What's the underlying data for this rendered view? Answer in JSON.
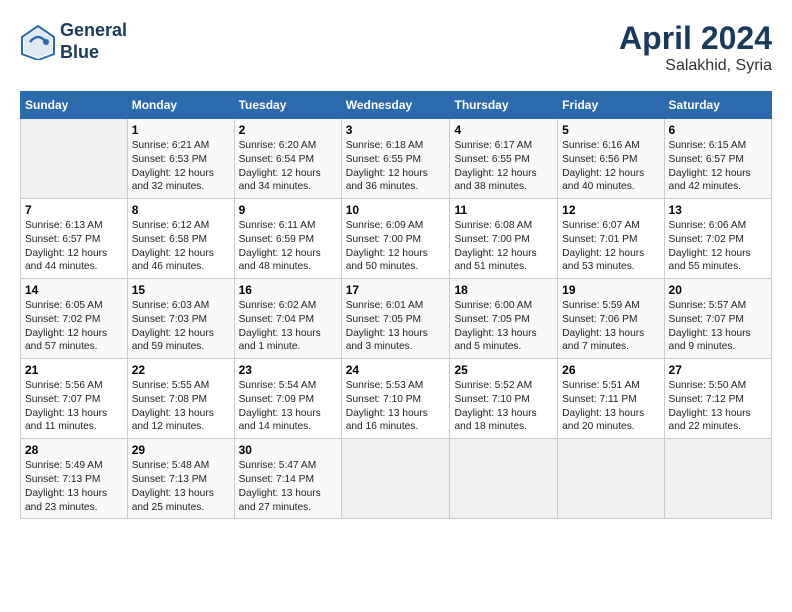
{
  "header": {
    "logo_line1": "General",
    "logo_line2": "Blue",
    "month": "April 2024",
    "location": "Salakhid, Syria"
  },
  "columns": [
    "Sunday",
    "Monday",
    "Tuesday",
    "Wednesday",
    "Thursday",
    "Friday",
    "Saturday"
  ],
  "rows": [
    [
      {
        "day": "",
        "info": ""
      },
      {
        "day": "1",
        "info": "Sunrise: 6:21 AM\nSunset: 6:53 PM\nDaylight: 12 hours\nand 32 minutes."
      },
      {
        "day": "2",
        "info": "Sunrise: 6:20 AM\nSunset: 6:54 PM\nDaylight: 12 hours\nand 34 minutes."
      },
      {
        "day": "3",
        "info": "Sunrise: 6:18 AM\nSunset: 6:55 PM\nDaylight: 12 hours\nand 36 minutes."
      },
      {
        "day": "4",
        "info": "Sunrise: 6:17 AM\nSunset: 6:55 PM\nDaylight: 12 hours\nand 38 minutes."
      },
      {
        "day": "5",
        "info": "Sunrise: 6:16 AM\nSunset: 6:56 PM\nDaylight: 12 hours\nand 40 minutes."
      },
      {
        "day": "6",
        "info": "Sunrise: 6:15 AM\nSunset: 6:57 PM\nDaylight: 12 hours\nand 42 minutes."
      }
    ],
    [
      {
        "day": "7",
        "info": "Sunrise: 6:13 AM\nSunset: 6:57 PM\nDaylight: 12 hours\nand 44 minutes."
      },
      {
        "day": "8",
        "info": "Sunrise: 6:12 AM\nSunset: 6:58 PM\nDaylight: 12 hours\nand 46 minutes."
      },
      {
        "day": "9",
        "info": "Sunrise: 6:11 AM\nSunset: 6:59 PM\nDaylight: 12 hours\nand 48 minutes."
      },
      {
        "day": "10",
        "info": "Sunrise: 6:09 AM\nSunset: 7:00 PM\nDaylight: 12 hours\nand 50 minutes."
      },
      {
        "day": "11",
        "info": "Sunrise: 6:08 AM\nSunset: 7:00 PM\nDaylight: 12 hours\nand 51 minutes."
      },
      {
        "day": "12",
        "info": "Sunrise: 6:07 AM\nSunset: 7:01 PM\nDaylight: 12 hours\nand 53 minutes."
      },
      {
        "day": "13",
        "info": "Sunrise: 6:06 AM\nSunset: 7:02 PM\nDaylight: 12 hours\nand 55 minutes."
      }
    ],
    [
      {
        "day": "14",
        "info": "Sunrise: 6:05 AM\nSunset: 7:02 PM\nDaylight: 12 hours\nand 57 minutes."
      },
      {
        "day": "15",
        "info": "Sunrise: 6:03 AM\nSunset: 7:03 PM\nDaylight: 12 hours\nand 59 minutes."
      },
      {
        "day": "16",
        "info": "Sunrise: 6:02 AM\nSunset: 7:04 PM\nDaylight: 13 hours\nand 1 minute."
      },
      {
        "day": "17",
        "info": "Sunrise: 6:01 AM\nSunset: 7:05 PM\nDaylight: 13 hours\nand 3 minutes."
      },
      {
        "day": "18",
        "info": "Sunrise: 6:00 AM\nSunset: 7:05 PM\nDaylight: 13 hours\nand 5 minutes."
      },
      {
        "day": "19",
        "info": "Sunrise: 5:59 AM\nSunset: 7:06 PM\nDaylight: 13 hours\nand 7 minutes."
      },
      {
        "day": "20",
        "info": "Sunrise: 5:57 AM\nSunset: 7:07 PM\nDaylight: 13 hours\nand 9 minutes."
      }
    ],
    [
      {
        "day": "21",
        "info": "Sunrise: 5:56 AM\nSunset: 7:07 PM\nDaylight: 13 hours\nand 11 minutes."
      },
      {
        "day": "22",
        "info": "Sunrise: 5:55 AM\nSunset: 7:08 PM\nDaylight: 13 hours\nand 12 minutes."
      },
      {
        "day": "23",
        "info": "Sunrise: 5:54 AM\nSunset: 7:09 PM\nDaylight: 13 hours\nand 14 minutes."
      },
      {
        "day": "24",
        "info": "Sunrise: 5:53 AM\nSunset: 7:10 PM\nDaylight: 13 hours\nand 16 minutes."
      },
      {
        "day": "25",
        "info": "Sunrise: 5:52 AM\nSunset: 7:10 PM\nDaylight: 13 hours\nand 18 minutes."
      },
      {
        "day": "26",
        "info": "Sunrise: 5:51 AM\nSunset: 7:11 PM\nDaylight: 13 hours\nand 20 minutes."
      },
      {
        "day": "27",
        "info": "Sunrise: 5:50 AM\nSunset: 7:12 PM\nDaylight: 13 hours\nand 22 minutes."
      }
    ],
    [
      {
        "day": "28",
        "info": "Sunrise: 5:49 AM\nSunset: 7:13 PM\nDaylight: 13 hours\nand 23 minutes."
      },
      {
        "day": "29",
        "info": "Sunrise: 5:48 AM\nSunset: 7:13 PM\nDaylight: 13 hours\nand 25 minutes."
      },
      {
        "day": "30",
        "info": "Sunrise: 5:47 AM\nSunset: 7:14 PM\nDaylight: 13 hours\nand 27 minutes."
      },
      {
        "day": "",
        "info": ""
      },
      {
        "day": "",
        "info": ""
      },
      {
        "day": "",
        "info": ""
      },
      {
        "day": "",
        "info": ""
      }
    ]
  ]
}
